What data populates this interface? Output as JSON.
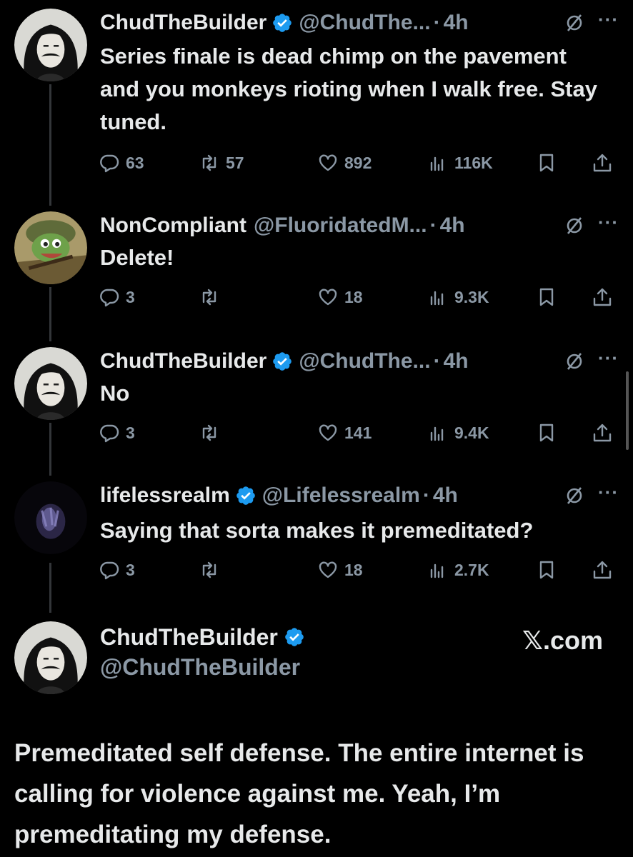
{
  "tweets": [
    {
      "name": "ChudTheBuilder",
      "verified": true,
      "handle": "@ChudThe...",
      "time": "4h",
      "text": "Series finale is dead chimp on the pavement and you monkeys rioting when I walk free. Stay tuned.",
      "replies": "63",
      "reposts": "57",
      "likes": "892",
      "views": "116K"
    },
    {
      "name": "NonCompliant",
      "verified": false,
      "handle": "@FluoridatedM...",
      "time": "4h",
      "text": "Delete!",
      "replies": "3",
      "reposts": "",
      "likes": "18",
      "views": "9.3K"
    },
    {
      "name": "ChudTheBuilder",
      "verified": true,
      "handle": "@ChudThe...",
      "time": "4h",
      "text": "No",
      "replies": "3",
      "reposts": "",
      "likes": "141",
      "views": "9.4K"
    },
    {
      "name": "lifelessrealm",
      "verified": true,
      "handle": "@Lifelessrealm",
      "time": "4h",
      "text": "Saying that sorta makes it premeditated?",
      "replies": "3",
      "reposts": "",
      "likes": "18",
      "views": "2.7K"
    }
  ],
  "main_post": {
    "name": "ChudTheBuilder",
    "handle": "@ChudTheBuilder",
    "site": "𝕏.com",
    "text": "Premeditated self defense. The entire internet is calling for violence against me. Yeah, I’m premeditating my defense."
  },
  "separator": "·",
  "more_label": "···",
  "icons": {
    "reply": "reply-icon",
    "repost": "repost-icon",
    "like": "like-icon",
    "views": "views-icon",
    "bookmark": "bookmark-icon",
    "share": "share-icon",
    "grok": "grok-icon",
    "verified": "verified-badge-icon"
  },
  "colors": {
    "background": "#000000",
    "text": "#e7e9ea",
    "muted": "#8b98a5",
    "verified": "#1d9bf0"
  }
}
